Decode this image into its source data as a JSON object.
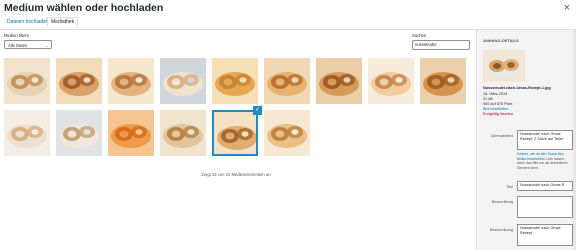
{
  "modal": {
    "title": "Medium wählen oder hochladen",
    "close_icon": "×"
  },
  "tabs": [
    {
      "label": "Dateien hochladen",
      "active": false
    },
    {
      "label": "Mediathek",
      "active": true
    }
  ],
  "filter": {
    "label": "Medien filtern",
    "selected": "Alle Daten"
  },
  "search": {
    "label": "Suchen",
    "value": "nussstrudel"
  },
  "grid": {
    "items": [
      {
        "colors": [
          "#e8d2b4",
          "#c79158",
          "#f1e3cc"
        ]
      },
      {
        "colors": [
          "#d9a067",
          "#a5622e",
          "#f2dbbb"
        ]
      },
      {
        "colors": [
          "#e2b280",
          "#b9783f",
          "#f6e7cf"
        ]
      },
      {
        "colors": [
          "#efe3d2",
          "#d8b184",
          "#cfd7dc"
        ]
      },
      {
        "colors": [
          "#e6a853",
          "#c98634",
          "#f5dfb5"
        ]
      },
      {
        "colors": [
          "#e7b36f",
          "#b87334",
          "#f0d8b2"
        ]
      },
      {
        "colors": [
          "#d89a5a",
          "#9e5c27",
          "#eaceA6"
        ]
      },
      {
        "colors": [
          "#efcda0",
          "#c98a4f",
          "#f7ecdc"
        ]
      },
      {
        "colors": [
          "#d6934f",
          "#a45f22",
          "#ead0ad"
        ]
      },
      {
        "colors": [
          "#ece0d0",
          "#d9b07e",
          "#f3ede4"
        ]
      },
      {
        "colors": [
          "#f0e7dc",
          "#c7a37a",
          "#dfe3e6"
        ]
      },
      {
        "colors": [
          "#ee9a48",
          "#d46f1f",
          "#f6c592"
        ]
      },
      {
        "colors": [
          "#e2c59c",
          "#b78447",
          "#f1e4cf"
        ]
      },
      {
        "colors": [
          "#e0ad6e",
          "#a8692d",
          "#f4e2c6"
        ]
      },
      {
        "colors": [
          "#e9bf86",
          "#c08243",
          "#f6e8d2"
        ]
      }
    ],
    "selected_index": 13
  },
  "count_text": "Zeigt 15 von 15 Medienelementen an",
  "details": {
    "heading": "ANHANG-DETAILS",
    "filename": "Nussstrudel-nach-Omas-Rezept-1.jpg",
    "date": "16. März 2019",
    "size": "31 kB",
    "dimensions": "900 auf 575 Pixel",
    "edit_link": "Bild bearbeiten",
    "delete_link": "Endgültig löschen",
    "alt_label": "Alternativtext",
    "alt_value": "Nussstrudel nach Omas Rezept: 2 Stück auf Teller",
    "alt_help_link": "Erfahre, wie du den Zweck des Bildes beschreibst",
    "alt_help_text": ". Leer lassen, wenn das Bild nur als dekoratives Element dient.",
    "title_label": "Titel",
    "title_value": "Nussstrudel nach Omas R",
    "caption_label": "Beschriftung",
    "caption_value": "",
    "desc_label": "Beschreibung",
    "desc_value": "Nussstrudel nach Omas Rezept"
  }
}
